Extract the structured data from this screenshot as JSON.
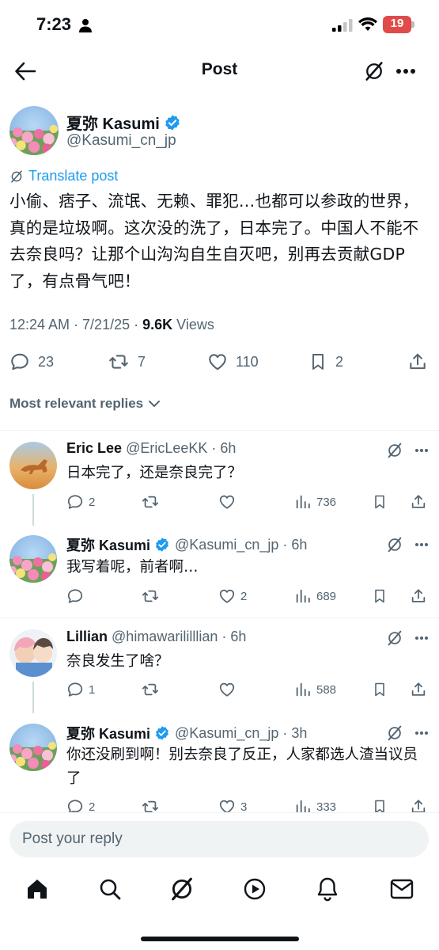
{
  "status_bar": {
    "time": "7:23",
    "battery": "19"
  },
  "header": {
    "title": "Post"
  },
  "post": {
    "author_name": "夏弥 Kasumi",
    "handle": "@Kasumi_cn_jp",
    "translate_label": "Translate post",
    "text": "小偷、痞子、流氓、无赖、罪犯…也都可以参政的世界，真的是垃圾啊。这次没的洗了，日本完了。中国人不能不去奈良吗？让那个山沟沟自生自灭吧，别再去贡献GDP了，有点骨气吧！",
    "timestamp": "12:24 AM · 7/21/25 · ",
    "views_count": "9.6K",
    "views_label": " Views",
    "replies": "23",
    "reposts": "7",
    "likes": "110",
    "bookmarks": "2"
  },
  "replies_filter": {
    "label": "Most relevant replies"
  },
  "replies": [
    {
      "name": "Eric Lee",
      "handle": "@EricLeeKK",
      "time": "· 6h",
      "text": "日本完了，还是奈良完了？",
      "replies": "2",
      "reposts": "",
      "likes": "",
      "views": "736"
    },
    {
      "name": "夏弥 Kasumi",
      "handle": "@Kasumi_cn_jp",
      "time": "· 6h",
      "text": "我写着呢，前者啊…",
      "replies": "",
      "reposts": "",
      "likes": "2",
      "views": "689"
    },
    {
      "name": "Lillian",
      "handle": "@himawarililllian",
      "time": "· 6h",
      "text": "奈良发生了啥？",
      "replies": "1",
      "reposts": "",
      "likes": "",
      "views": "588"
    },
    {
      "name": "夏弥 Kasumi",
      "handle": "@Kasumi_cn_jp",
      "time": "· 3h",
      "text": "你还没刷到啊！别去奈良了反正，人家都选人渣当议员了",
      "replies": "2",
      "reposts": "",
      "likes": "3",
      "views": "333"
    }
  ],
  "composer": {
    "placeholder": "Post your reply"
  },
  "colors": {
    "accent": "#1d9bf0",
    "text": "#0f1419",
    "muted": "#536471",
    "verified": "#1d9bf0"
  },
  "icons": {
    "nav": [
      "home-icon",
      "search-icon",
      "grok-icon",
      "video-icon",
      "notifications-icon",
      "messages-icon"
    ]
  }
}
